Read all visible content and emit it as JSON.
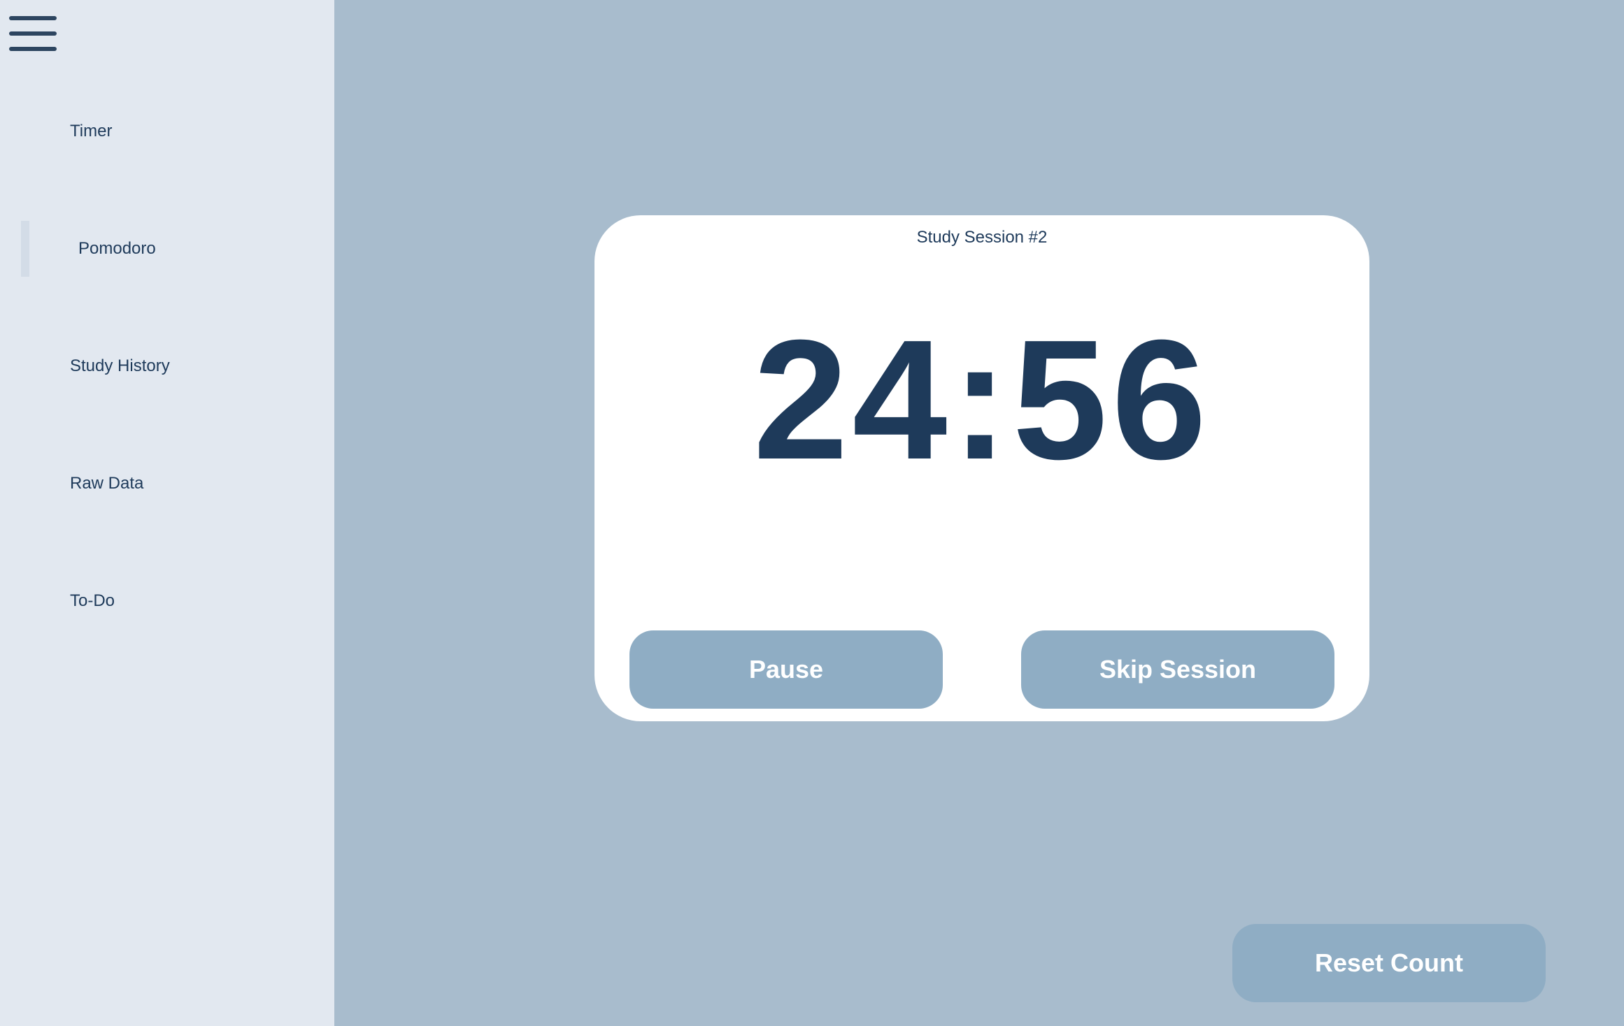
{
  "sidebar": {
    "menu_icon": "hamburger-menu-icon",
    "items": [
      {
        "label": "Timer"
      },
      {
        "label": "Pomodoro",
        "active": true
      },
      {
        "label": "Study History"
      },
      {
        "label": "Raw Data"
      },
      {
        "label": "To-Do"
      }
    ]
  },
  "timer": {
    "session_title": "Study Session #2",
    "time": "24:56",
    "pause_label": "Pause",
    "skip_label": "Skip Session"
  },
  "footer": {
    "reset_label": "Reset Count"
  },
  "colors": {
    "background": "#a8bccd",
    "sidebar": "#e2e8f0",
    "card": "#ffffff",
    "button": "#8fadc4",
    "text": "#1e3a5a"
  }
}
